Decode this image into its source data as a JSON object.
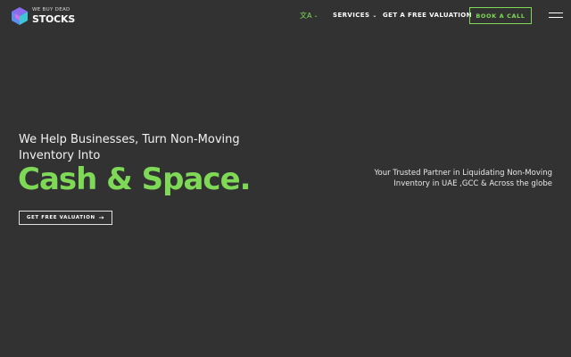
{
  "brand": {
    "small_text": "WE BUY DEAD",
    "big_text": "STOCKS",
    "colors": {
      "accent": "#7ed957",
      "background": "#323232"
    }
  },
  "nav": {
    "language": {
      "glyph": "文A",
      "icon": "chevron-down-icon"
    },
    "services": "SERVICES",
    "valuation": "GET A FREE VALUATION",
    "book_call": "BOOK A CALL",
    "menu_icon": "hamburger-icon"
  },
  "hero": {
    "subtitle": "We Help Businesses, Turn Non-Moving Inventory Into",
    "headline": "Cash & Space.",
    "cta_label": "GET FREE VALUATION",
    "cta_icon": "arrow-right-icon",
    "tagline": "Your Trusted Partner in Liquidating Non-Moving Inventory in UAE ,GCC & Across the globe"
  }
}
